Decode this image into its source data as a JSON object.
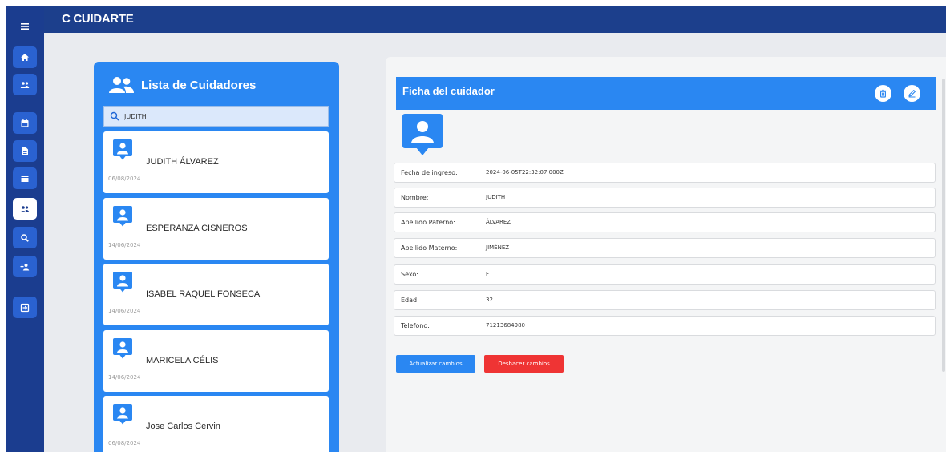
{
  "app": {
    "title": "C CUIDARTE"
  },
  "sidebar": {
    "items": [
      {
        "icon": "menu-icon"
      },
      {
        "icon": "home-icon"
      },
      {
        "icon": "users-icon"
      },
      {
        "icon": "calendar-icon"
      },
      {
        "icon": "file-icon"
      },
      {
        "icon": "list-icon"
      },
      {
        "icon": "caregivers-icon",
        "active": true
      },
      {
        "icon": "search-icon"
      },
      {
        "icon": "add-user-icon"
      },
      {
        "icon": "logout-icon"
      }
    ]
  },
  "list": {
    "title": "Lista de Cuidadores",
    "search_value": "JUDITH",
    "items": [
      {
        "name": "JUDITH ÁLVAREZ",
        "date": "06/08/2024"
      },
      {
        "name": "ESPERANZA CISNEROS",
        "date": "14/06/2024"
      },
      {
        "name": "ISABEL RAQUEL FONSECA",
        "date": "14/06/2024"
      },
      {
        "name": "MARICELA CÉLIS",
        "date": "14/06/2024"
      },
      {
        "name": "Jose Carlos Cervin",
        "date": "06/08/2024"
      }
    ]
  },
  "detail": {
    "title": "Ficha del cuidador",
    "fields": [
      {
        "label": "Fecha de ingreso:",
        "value": "2024-06-05T22:32:07.000Z"
      },
      {
        "label": "Nombre:",
        "value": "JUDITH"
      },
      {
        "label": "Apellido Paterno:",
        "value": "ÁLVAREZ"
      },
      {
        "label": "Apellido Materno:",
        "value": "JIMÉNEZ"
      },
      {
        "label": "Sexo:",
        "value": "F"
      },
      {
        "label": "Edad:",
        "value": "32"
      },
      {
        "label": "Telefono:",
        "value": "71213684980"
      }
    ],
    "save_label": "Actualizar cambios",
    "undo_label": "Deshacer cambios"
  },
  "colors": {
    "rail": "#1b3d8f",
    "header": "#1c3f8c",
    "accent": "#2a87f2",
    "danger": "#ef3434"
  }
}
